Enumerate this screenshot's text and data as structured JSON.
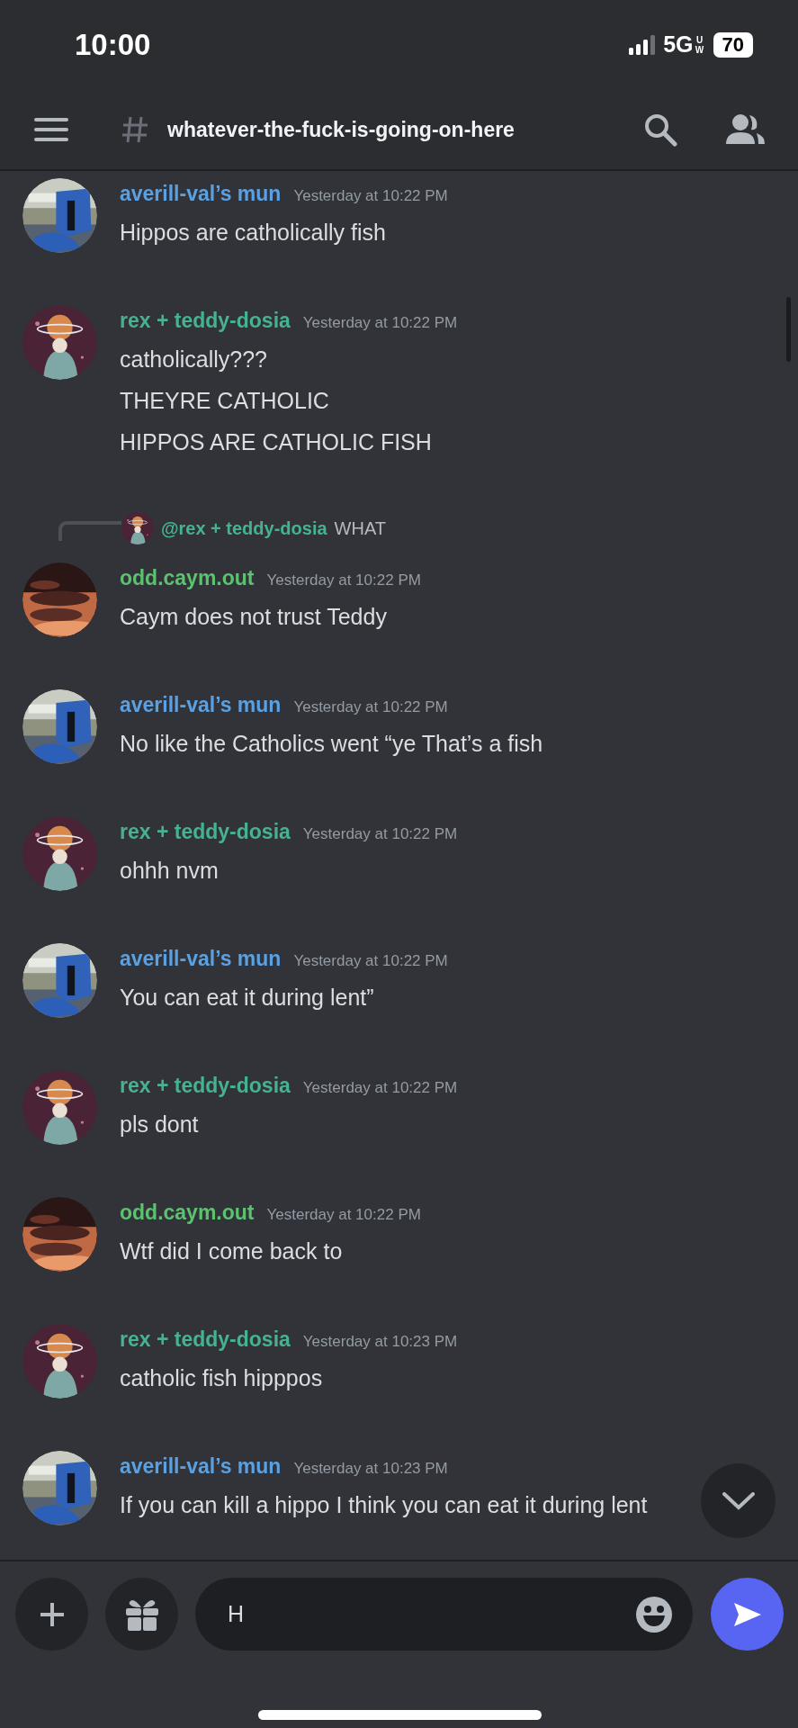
{
  "status_bar": {
    "time": "10:00",
    "network": "5G",
    "network_badge": "UW",
    "battery": "70"
  },
  "header": {
    "channel": "whatever-the-fuck-is-going-on-here"
  },
  "messages": [
    {
      "author": "averill-val’s mun",
      "color": "#5ba0e0",
      "avatar": {
        "kind": "helmet"
      },
      "time": "Yesterday at 10:22 PM",
      "lines": [
        "Hippos are catholically fish"
      ]
    },
    {
      "author": "rex + teddy-dosia",
      "color": "#45b390",
      "avatar": {
        "kind": "planet"
      },
      "time": "Yesterday at 10:22 PM",
      "lines": [
        "catholically???",
        "THEYRE CATHOLIC",
        "HIPPOS ARE CATHOLIC FISH"
      ]
    },
    {
      "author": "odd.caym.out",
      "color": "#5cc270",
      "avatar": {
        "kind": "sunset"
      },
      "time": "Yesterday at 10:22 PM",
      "lines": [
        "Caym does not trust Teddy"
      ],
      "reply": {
        "author": "@rex + teddy-dosia",
        "color": "#45b390",
        "avatar": {
          "kind": "planet"
        },
        "text": "WHAT"
      }
    },
    {
      "author": "averill-val’s mun",
      "color": "#5ba0e0",
      "avatar": {
        "kind": "helmet"
      },
      "time": "Yesterday at 10:22 PM",
      "lines": [
        "No like the Catholics went “ye That’s a fish"
      ]
    },
    {
      "author": "rex + teddy-dosia",
      "color": "#45b390",
      "avatar": {
        "kind": "planet"
      },
      "time": "Yesterday at 10:22 PM",
      "lines": [
        "ohhh nvm"
      ]
    },
    {
      "author": "averill-val’s mun",
      "color": "#5ba0e0",
      "avatar": {
        "kind": "helmet"
      },
      "time": "Yesterday at 10:22 PM",
      "lines": [
        "You can eat it during lent”"
      ]
    },
    {
      "author": "rex + teddy-dosia",
      "color": "#45b390",
      "avatar": {
        "kind": "planet"
      },
      "time": "Yesterday at 10:22 PM",
      "lines": [
        "pls dont"
      ]
    },
    {
      "author": "odd.caym.out",
      "color": "#5cc270",
      "avatar": {
        "kind": "sunset"
      },
      "time": "Yesterday at 10:22 PM",
      "lines": [
        "Wtf did I come back to"
      ]
    },
    {
      "author": "rex + teddy-dosia",
      "color": "#45b390",
      "avatar": {
        "kind": "planet"
      },
      "time": "Yesterday at 10:23 PM",
      "lines": [
        "catholic fish hipppos"
      ]
    },
    {
      "author": "averill-val’s mun",
      "color": "#5ba0e0",
      "avatar": {
        "kind": "helmet"
      },
      "time": "Yesterday at 10:23 PM",
      "lines": [
        "If you can kill a hippo I think you can eat it during lent"
      ]
    }
  ],
  "composer": {
    "value": "H"
  }
}
